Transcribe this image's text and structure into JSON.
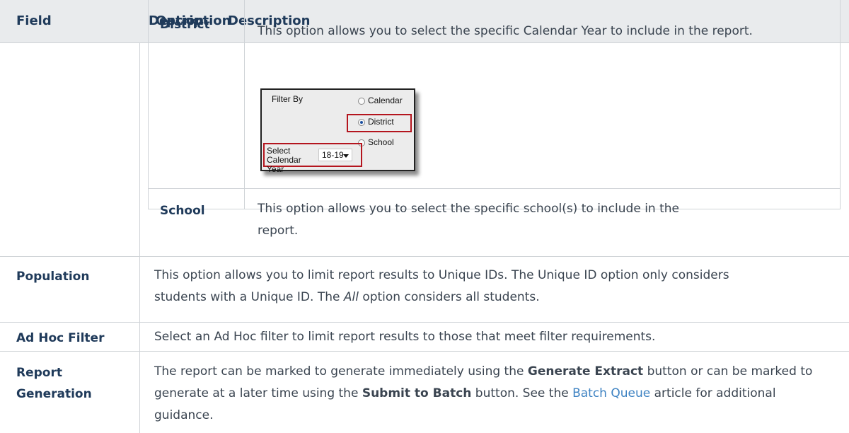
{
  "header": {
    "field_label": "Field",
    "description_label": "Description",
    "option_label": "Option",
    "option_description_label": "Description"
  },
  "filter_options": [
    {
      "name": "District",
      "description": "This option allows you to select the specific Calendar Year to include in the report.",
      "screenshot": {
        "filter_by_label": "Filter By",
        "radio_options": [
          "Calendar",
          "District",
          "School"
        ],
        "selected_option": "District",
        "select_calendar_label": "Select Calendar Year",
        "select_calendar_value": "18-19"
      }
    },
    {
      "name": "School",
      "description": "This option allows you to select the specific school(s) to include in the report."
    }
  ],
  "rows": {
    "population": {
      "field": "Population",
      "description_before": "This option allows you to limit report results to Unique IDs. The Unique ID option only considers students with a Unique ID. The ",
      "description_em": "All",
      "description_after": " option considers all students."
    },
    "ad_hoc": {
      "field": "Ad Hoc Filter",
      "description": "Select an Ad Hoc filter to limit report results to those that meet filter requirements."
    },
    "report_generation": {
      "field": "Report Generation",
      "part1": "The report can be marked to generate immediately using the ",
      "bold1": "Generate Extract",
      "part2": " button or can be marked to generate at a later time using the ",
      "bold2": "Submit to Batch",
      "part3": " button. See the ",
      "link": "Batch Queue",
      "part4": " article for additional guidance."
    }
  }
}
